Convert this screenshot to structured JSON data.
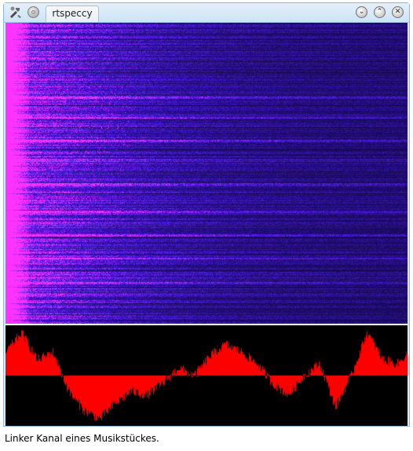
{
  "window": {
    "title": "rtspeccy",
    "buttons": {
      "minimize_glyph": "⌄",
      "maximize_glyph": "⌃",
      "close_glyph": "✕"
    }
  },
  "icons": {
    "app": "app-tools-icon",
    "sticky": "sticky-pin-icon"
  },
  "colors": {
    "spectrogram_background": "#0a0638",
    "spectrogram_high": "#ff33ff",
    "spectrogram_mid": "#5a1cf0",
    "waveform_fill": "#ff0000",
    "waveform_background": "#000000"
  },
  "caption": "Linker Kanal eines Musikstückes."
}
